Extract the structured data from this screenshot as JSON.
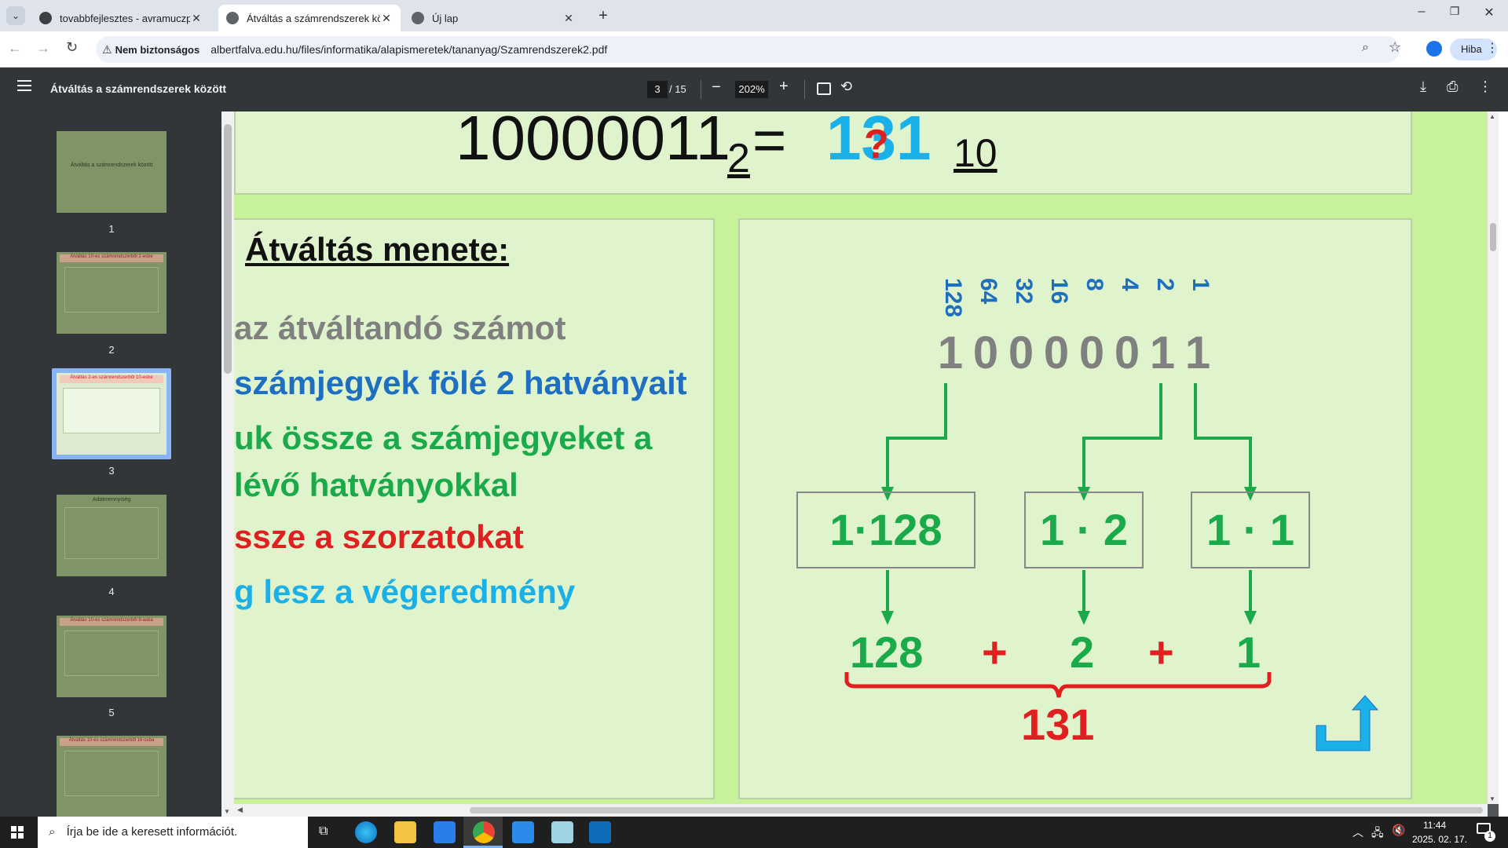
{
  "tabs": [
    {
      "title": "tovabbfejlesztes - avramuczpist",
      "active": false
    },
    {
      "title": "Átváltás a számrendszerek közö",
      "active": true
    },
    {
      "title": "Új lap",
      "active": false
    }
  ],
  "toolbar": {
    "security_label": "Nem biztonságos",
    "url": "albertfalva.edu.hu/files/informatika/alapismeretek/tananyag/Szamrendszerek2.pdf",
    "profile_label": "Hiba"
  },
  "pdf": {
    "title": "Átváltás a számrendszerek között",
    "current_page": "3",
    "total_pages": "/ 15",
    "zoom": "202%"
  },
  "thumbnails": [
    {
      "num": "1",
      "caption": "Átváltás a számrendszerek között"
    },
    {
      "num": "2",
      "caption": "Átváltás 10-es számrendszerből 2-esbe"
    },
    {
      "num": "3",
      "caption": "Átváltás 2-es számrendszerből 10-esbe"
    },
    {
      "num": "4",
      "caption": "Adatmennyiség"
    },
    {
      "num": "5",
      "caption": "Átváltás 10-es számrendszerből 8-asba"
    },
    {
      "num": "6",
      "caption": "Átváltás 10-es számrendszerből 16-osba"
    }
  ],
  "slide": {
    "binary_number": "10000011",
    "binary_base": "2",
    "equals": "=",
    "result_number": "131",
    "question_mark": "?",
    "result_base": "10",
    "heading": "Átváltás menete:",
    "steps": [
      {
        "text": "az átváltandó számot",
        "color": "#808080"
      },
      {
        "text": "számjegyek fölé 2 hatványait",
        "color": "#1f6fc0"
      },
      {
        "text": "uk össze a számjegyeket a",
        "color": "#1aaa4a"
      },
      {
        "text": "lévő hatványokkal",
        "color": "#1aaa4a"
      },
      {
        "text": "ssze a szorzatokat",
        "color": "#e02020"
      },
      {
        "text": "g lesz a végeredmény",
        "color": "#1ab0e8"
      }
    ],
    "powers": [
      "128",
      "64",
      "32",
      "16",
      "8",
      "4",
      "2",
      "1"
    ],
    "digits": [
      "1",
      "0",
      "0",
      "0",
      "0",
      "0",
      "1",
      "1"
    ],
    "products": [
      "1·128",
      "1 · 2",
      "1 · 1"
    ],
    "terms": [
      "128",
      "+",
      "2",
      "+",
      "1"
    ],
    "sum": "131"
  },
  "taskbar": {
    "search_placeholder": "Írja be ide a keresett információt.",
    "time": "11:44",
    "date": "2025. 02. 17.",
    "notification_count": "1"
  },
  "colors": {
    "slide_bg": "#c7f19a",
    "box_bg": "#dff3cc",
    "green": "#1aaa4a",
    "blue": "#1f6fc0",
    "red": "#e02020",
    "cyan": "#1ab0e8",
    "gray": "#808080"
  }
}
